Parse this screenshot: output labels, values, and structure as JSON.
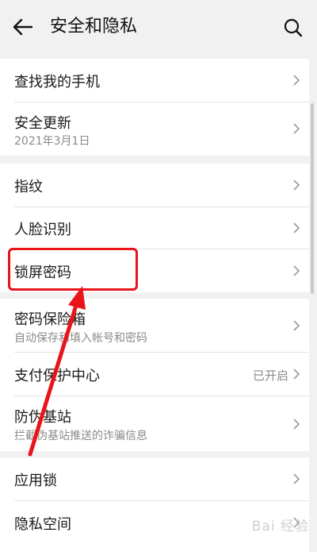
{
  "header": {
    "title": "安全和隐私",
    "back_icon": "arrow-left-icon",
    "search_icon": "search-icon"
  },
  "groups": [
    {
      "items": [
        {
          "label": "查找我的手机"
        },
        {
          "label": "安全更新",
          "sub": "2021年3月1日"
        }
      ]
    },
    {
      "items": [
        {
          "label": "指纹"
        },
        {
          "label": "人脸识别"
        },
        {
          "label": "锁屏密码"
        }
      ]
    },
    {
      "items": [
        {
          "label": "密码保险箱",
          "sub": "自动保存和填入帐号和密码"
        },
        {
          "label": "支付保护中心",
          "value": "已开启"
        },
        {
          "label": "防伪基站",
          "sub": "拦截伪基站推送的诈骗信息"
        }
      ]
    },
    {
      "items": [
        {
          "label": "应用锁"
        },
        {
          "label": "隐私空间"
        }
      ]
    }
  ],
  "annotation": {
    "color": "#e8141a"
  },
  "watermark": {
    "text": "Bai 经验"
  }
}
